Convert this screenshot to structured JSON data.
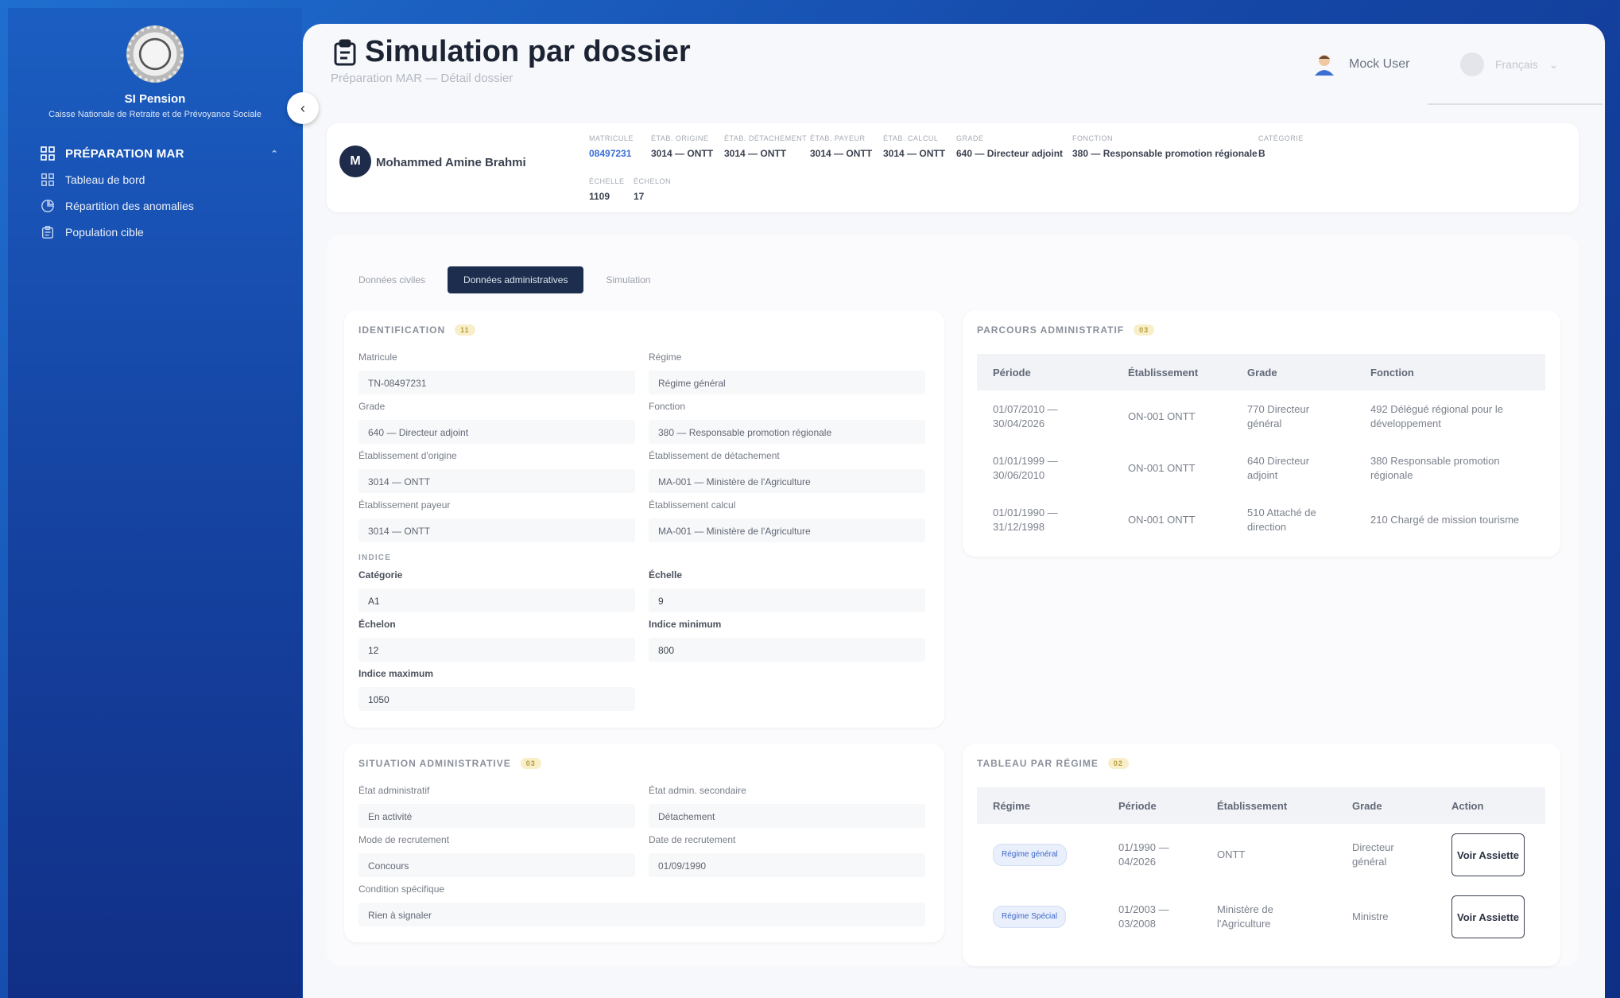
{
  "sidebar": {
    "brand_name": "SI Pension",
    "brand_sub": "Caisse Nationale de Retraite et de Prévoyance Sociale",
    "group_label": "PRÉPARATION MAR",
    "items": [
      {
        "label": "Tableau de bord",
        "icon": "dashboard-icon"
      },
      {
        "label": "Répartition des anomalies",
        "icon": "anomaly-icon"
      },
      {
        "label": "Population cible",
        "icon": "clipboard-icon"
      }
    ]
  },
  "header": {
    "title": "Simulation par dossier",
    "subtitle": "Préparation MAR — Détail dossier",
    "user_name": "Mock User",
    "language": "Français"
  },
  "employee": {
    "initial": "M",
    "name": "Mohammed Amine Brahmi",
    "meta": [
      {
        "key": "MATRICULE",
        "value": "08497231"
      },
      {
        "key": "ÉTAB. ORIGINE",
        "value": "3014 — ONTT"
      },
      {
        "key": "ÉTAB. DÉTACHEMENT",
        "value": "3014 — ONTT"
      },
      {
        "key": "ÉTAB. PAYEUR",
        "value": "3014 — ONTT"
      },
      {
        "key": "ÉTAB. CALCUL",
        "value": "3014 — ONTT"
      },
      {
        "key": "GRADE",
        "value": "640 — Directeur adjoint"
      },
      {
        "key": "FONCTION",
        "value": "380 — Responsable promotion régionale"
      },
      {
        "key": "CATÉGORIE",
        "value": "B"
      },
      {
        "key": "ÉCHELLE",
        "value": "1109"
      },
      {
        "key": "ÉCHELON",
        "value": "17"
      }
    ]
  },
  "tabs": [
    "Données civiles",
    "Données administratives",
    "Simulation"
  ],
  "identification": {
    "title": "IDENTIFICATION",
    "badge": "11",
    "fields": [
      {
        "label": "Matricule",
        "value": "TN-08497231"
      },
      {
        "label": "Régime",
        "value": "Régime général"
      },
      {
        "label": "Grade",
        "value": "640 — Directeur adjoint"
      },
      {
        "label": "Fonction",
        "value": "380 — Responsable promotion régionale"
      },
      {
        "label": "Établissement d'origine",
        "value": "3014 — ONTT"
      },
      {
        "label": "Établissement de détachement",
        "value": "MA-001 — Ministère de l'Agriculture"
      },
      {
        "label": "Établissement payeur",
        "value": "3014 — ONTT"
      },
      {
        "label": "Établissement calcul",
        "value": "MA-001 — Ministère de l'Agriculture"
      }
    ],
    "indice_label": "INDICE",
    "indice_fields": [
      {
        "label": "Catégorie",
        "value": "A1"
      },
      {
        "label": "Échelle",
        "value": "9"
      },
      {
        "label": "Échelon",
        "value": "12"
      },
      {
        "label": "Indice minimum",
        "value": "800"
      },
      {
        "label": "Indice maximum",
        "value": "1050"
      }
    ]
  },
  "parcours": {
    "title": "PARCOURS ADMINISTRATIF",
    "badge": "03",
    "columns": [
      "Période",
      "Établissement",
      "Grade",
      "Fonction"
    ],
    "rows": [
      [
        "01/07/2010 — 30/04/2026",
        "ON-001 ONTT",
        "770 Directeur général",
        "492 Délégué régional pour le développement"
      ],
      [
        "01/01/1999 — 30/06/2010",
        "ON-001 ONTT",
        "640 Directeur adjoint",
        "380 Responsable promotion régionale"
      ],
      [
        "01/01/1990 — 31/12/1998",
        "ON-001 ONTT",
        "510 Attaché de direction",
        "210 Chargé de mission tourisme"
      ]
    ]
  },
  "situation": {
    "title": "SITUATION ADMINISTRATIVE",
    "badge": "03",
    "fields": [
      {
        "label": "État administratif",
        "value": "En activité"
      },
      {
        "label": "État admin. secondaire",
        "value": "Détachement"
      },
      {
        "label": "Mode de recrutement",
        "value": "Concours"
      },
      {
        "label": "Date de recrutement",
        "value": "01/09/1990"
      },
      {
        "label": "Condition spécifique",
        "value": "Rien à signaler"
      }
    ]
  },
  "regime_table": {
    "title": "TABLEAU PAR RÉGIME",
    "badge": "02",
    "columns": [
      "Régime",
      "Période",
      "Établissement",
      "Grade",
      "Action"
    ],
    "rows": [
      {
        "regime": "Régime général",
        "periode": "01/1990 — 04/2026",
        "etab": "ONTT",
        "grade": "Directeur général",
        "action": "Voir Assiette"
      },
      {
        "regime": "Régime Spécial",
        "periode": "01/2003 — 03/2008",
        "etab": "Ministère de l'Agriculture",
        "grade": "Ministre",
        "action": "Voir Assiette"
      }
    ]
  }
}
